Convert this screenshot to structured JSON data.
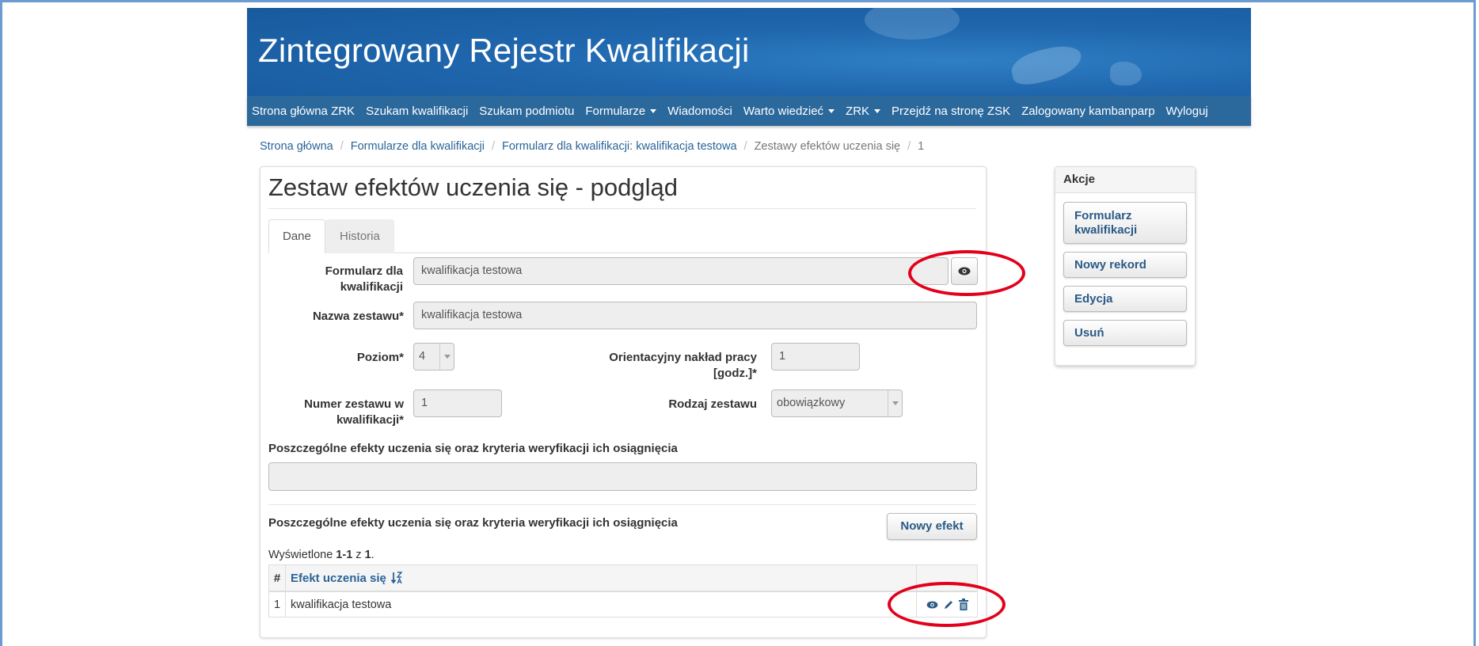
{
  "header": {
    "title": "Zintegrowany Rejestr Kwalifikacji"
  },
  "nav": {
    "items": [
      "Strona główna ZRK",
      "Szukam kwalifikacji",
      "Szukam podmiotu",
      "Formularze",
      "Wiadomości",
      "Warto wiedzieć",
      "ZRK",
      "Przejdź na stronę ZSK",
      "Zalogowany kambanparp",
      "Wyloguj"
    ]
  },
  "breadcrumb": {
    "items": [
      "Strona główna",
      "Formularze dla kwalifikacji",
      "Formularz dla kwalifikacji: kwalifikacja testowa",
      "Zestawy efektów uczenia się"
    ],
    "current": "1",
    "separator": "/"
  },
  "page": {
    "title": "Zestaw efektów uczenia się - podgląd"
  },
  "tabs": [
    "Dane",
    "Historia"
  ],
  "form": {
    "formularz_label": "Formularz dla kwalifikacji",
    "formularz_value": "kwalifikacja testowa",
    "nazwa_label": "Nazwa zestawu*",
    "nazwa_value": "kwalifikacja testowa",
    "poziom_label": "Poziom*",
    "poziom_value": "4",
    "naklad_label_line1": "Orientacyjny nakład pracy",
    "naklad_label_line2": "[godz.]*",
    "naklad_value": "1",
    "numer_label_line1": "Numer zestawu w",
    "numer_label_line2": "kwalifikacji*",
    "numer_value": "1",
    "rodzaj_label": "Rodzaj zestawu",
    "rodzaj_value": "obowiązkowy",
    "efekty_label": "Poszczególne efekty uczenia się oraz kryteria weryfikacji ich osiągnięcia",
    "efekty_value": ""
  },
  "efekty_section": {
    "title": "Poszczególne efekty uczenia się oraz kryteria weryfikacji ich osiągnięcia",
    "new_button": "Nowy efekt",
    "summary_prefix": "Wyświetlone ",
    "summary_range": "1-1",
    "summary_mid": " z ",
    "summary_total": "1",
    "summary_suffix": ".",
    "table": {
      "headers": [
        "#",
        "Efekt uczenia się"
      ],
      "rows": [
        {
          "num": "1",
          "name": "kwalifikacja testowa"
        }
      ]
    }
  },
  "actions": {
    "title": "Akcje",
    "buttons": [
      "Formularz kwalifikacji",
      "Nowy rekord",
      "Edycja",
      "Usuń"
    ]
  },
  "colors": {
    "header_blue": "#1f66ad",
    "nav_blue": "#2b689c",
    "link_blue": "#2a6496",
    "highlight_red": "#e3001b"
  },
  "icons": {
    "view": "eye-icon",
    "edit": "pencil-icon",
    "delete": "trash-icon",
    "sort": "sort-alpha-icon"
  }
}
